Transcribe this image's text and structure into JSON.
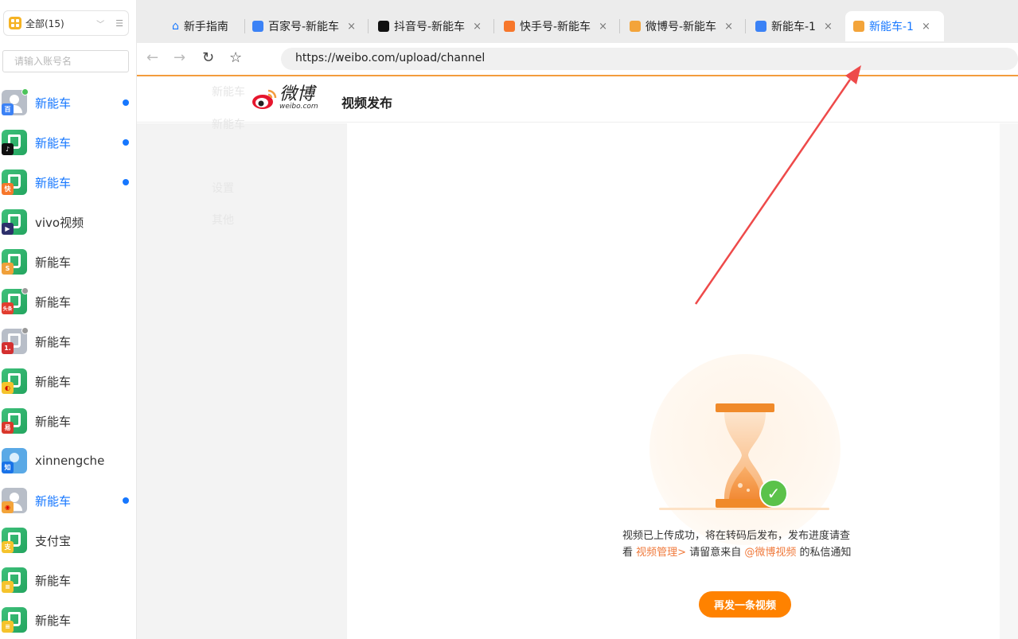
{
  "sidebar": {
    "group_label": "全部(15)",
    "search_placeholder": "请输入账号名",
    "accounts": [
      {
        "name": "新能车",
        "platform": "baijiahao",
        "active": true,
        "unread": true
      },
      {
        "name": "新能车",
        "platform": "douyin",
        "active": true,
        "unread": true
      },
      {
        "name": "新能车",
        "platform": "kuaishou",
        "active": true,
        "unread": true
      },
      {
        "name": "vivo视频",
        "platform": "vivo",
        "active": false,
        "unread": false
      },
      {
        "name": "新能车",
        "platform": "sohu",
        "active": false,
        "unread": false
      },
      {
        "name": "新能车",
        "platform": "toutiao",
        "active": false,
        "unread": false
      },
      {
        "name": "新能车",
        "platform": "yidian",
        "active": false,
        "unread": false
      },
      {
        "name": "新能车",
        "platform": "haokan",
        "active": false,
        "unread": false
      },
      {
        "name": "新能车",
        "platform": "wangyi",
        "active": false,
        "unread": false
      },
      {
        "name": "xinnengche",
        "platform": "zhihu",
        "active": false,
        "unread": false
      },
      {
        "name": "新能车",
        "platform": "weibo",
        "active": true,
        "unread": true
      },
      {
        "name": "支付宝",
        "platform": "alipay",
        "active": false,
        "unread": false
      },
      {
        "name": "新能车",
        "platform": "other",
        "active": false,
        "unread": false
      },
      {
        "name": "新能车",
        "platform": "other",
        "active": false,
        "unread": false
      }
    ]
  },
  "tabs": [
    {
      "label": "新手指南",
      "icon": "home-icon",
      "closable": false
    },
    {
      "label": "百家号-新能车",
      "icon": "baijiahao-icon",
      "closable": true
    },
    {
      "label": "抖音号-新能车",
      "icon": "douyin-icon",
      "closable": true
    },
    {
      "label": "快手号-新能车",
      "icon": "kuaishou-icon",
      "closable": true
    },
    {
      "label": "微博号-新能车",
      "icon": "weibo-icon",
      "closable": true
    },
    {
      "label": "新能车-1",
      "icon": "baijiahao-icon",
      "closable": true
    },
    {
      "label": "新能车-1",
      "icon": "weibo-icon",
      "closable": true,
      "active": true
    }
  ],
  "nav": {
    "url": "https://weibo.com/upload/channel"
  },
  "weibo": {
    "logo_text": "微博",
    "logo_sub": "weibo.com",
    "page_title": "视频发布"
  },
  "ghost_menu": [
    "新能车",
    "新能车",
    "设置",
    "其他"
  ],
  "upload": {
    "msg_line1": "视频已上传成功，将在转码后发布，发布进度请查",
    "msg_line2_a": "看",
    "msg_link1": "视频管理>",
    "msg_line2_b": "请留意来自",
    "msg_link2": "@微博视频",
    "msg_line2_c": "的私信通知",
    "resend_label": "再发一条视频"
  },
  "colors": {
    "accent_blue": "#1677ff",
    "weibo_orange": "#ff8200",
    "tab_bg": "#ececec"
  }
}
